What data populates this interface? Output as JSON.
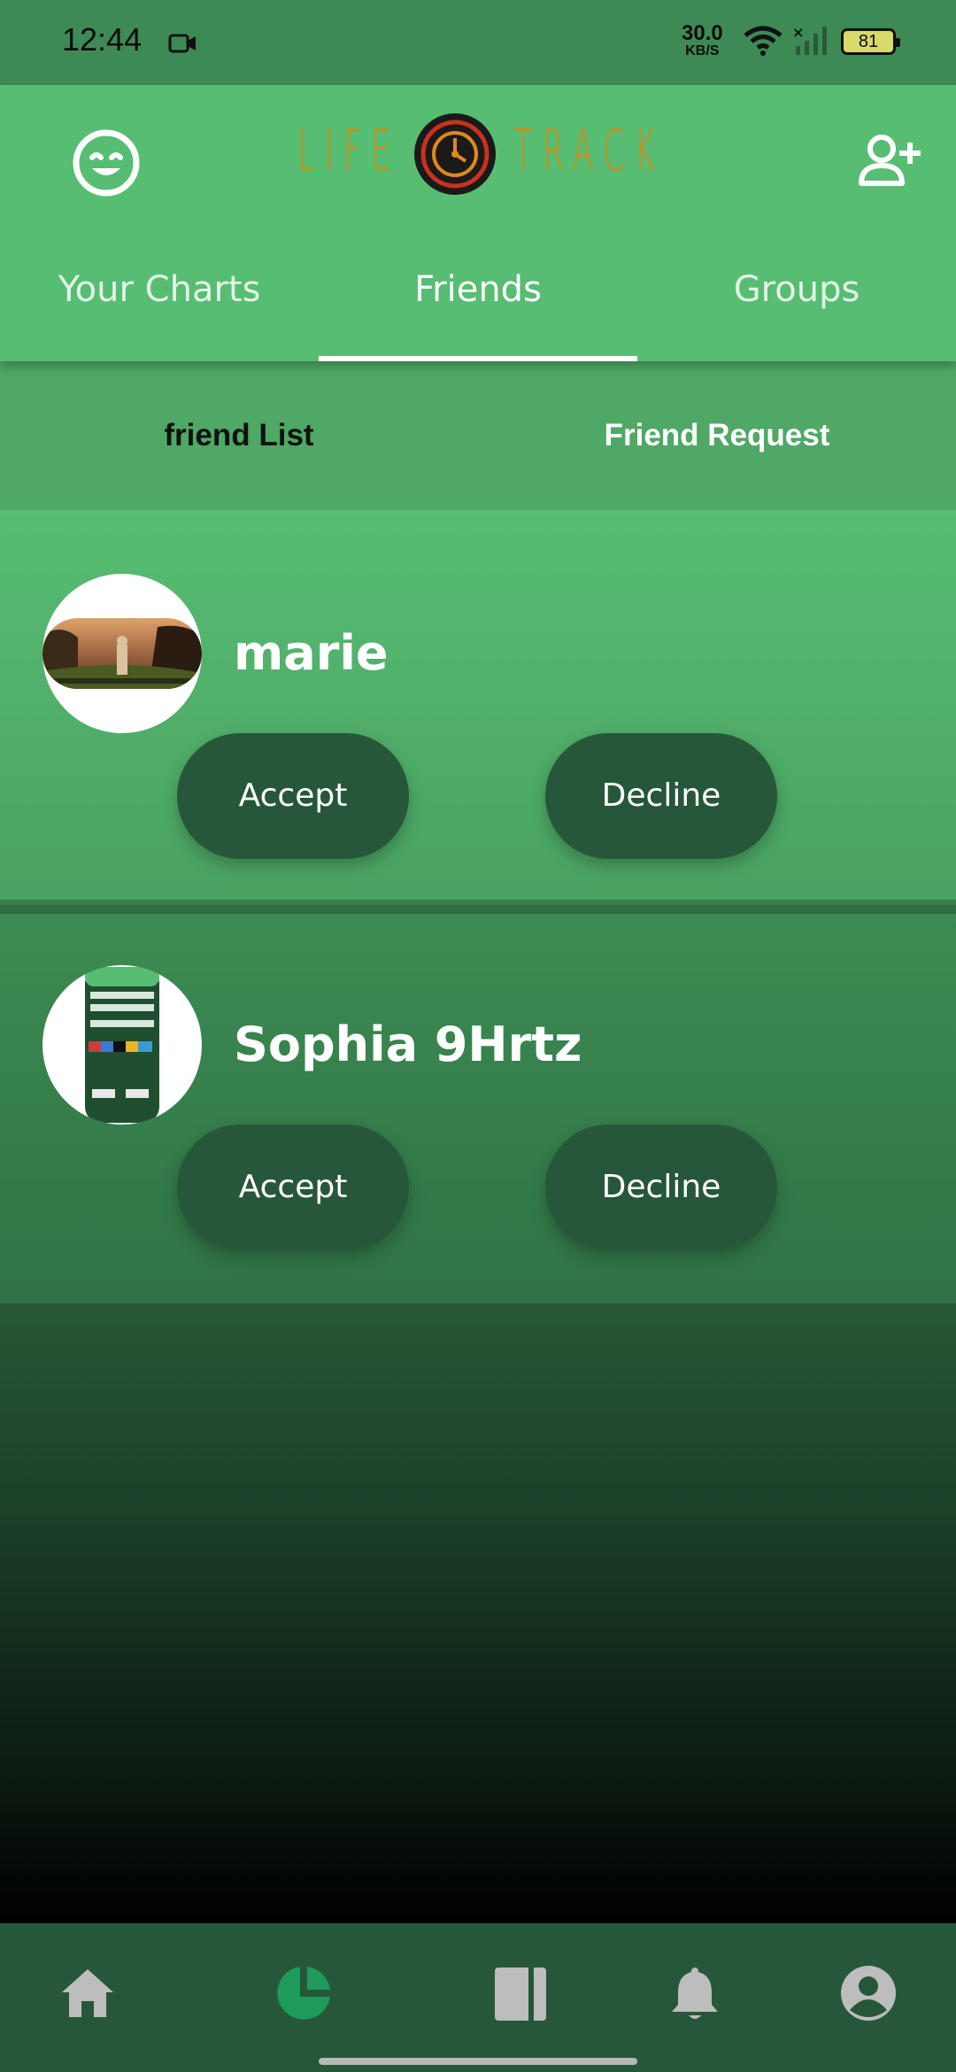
{
  "status_bar": {
    "time": "12:44",
    "speed_value": "30.0",
    "speed_unit": "KB/S",
    "battery": "81"
  },
  "header": {
    "logo_left": "LIFE",
    "logo_right": "TRACK"
  },
  "tabs": [
    {
      "label": "Your Charts",
      "active": false
    },
    {
      "label": "Friends",
      "active": true
    },
    {
      "label": "Groups",
      "active": false
    }
  ],
  "subtabs": {
    "friend_list": "friend List",
    "friend_request": "Friend Request"
  },
  "requests": [
    {
      "name": "marie",
      "accept_label": "Accept",
      "decline_label": "Decline"
    },
    {
      "name": "Sophia 9Hrtz",
      "accept_label": "Accept",
      "decline_label": "Decline"
    }
  ],
  "colors": {
    "accent_green": "#57bd72",
    "dark_green": "#27573a",
    "logo_orange": "#d68a16",
    "active_nav_icon": "#1e9a5a",
    "inactive_nav_icon": "#bdbdbd"
  },
  "nav": {
    "items": [
      {
        "icon": "home-icon"
      },
      {
        "icon": "pie-chart-icon",
        "active": true
      },
      {
        "icon": "journal-icon"
      },
      {
        "icon": "bell-icon"
      },
      {
        "icon": "profile-icon"
      }
    ]
  }
}
